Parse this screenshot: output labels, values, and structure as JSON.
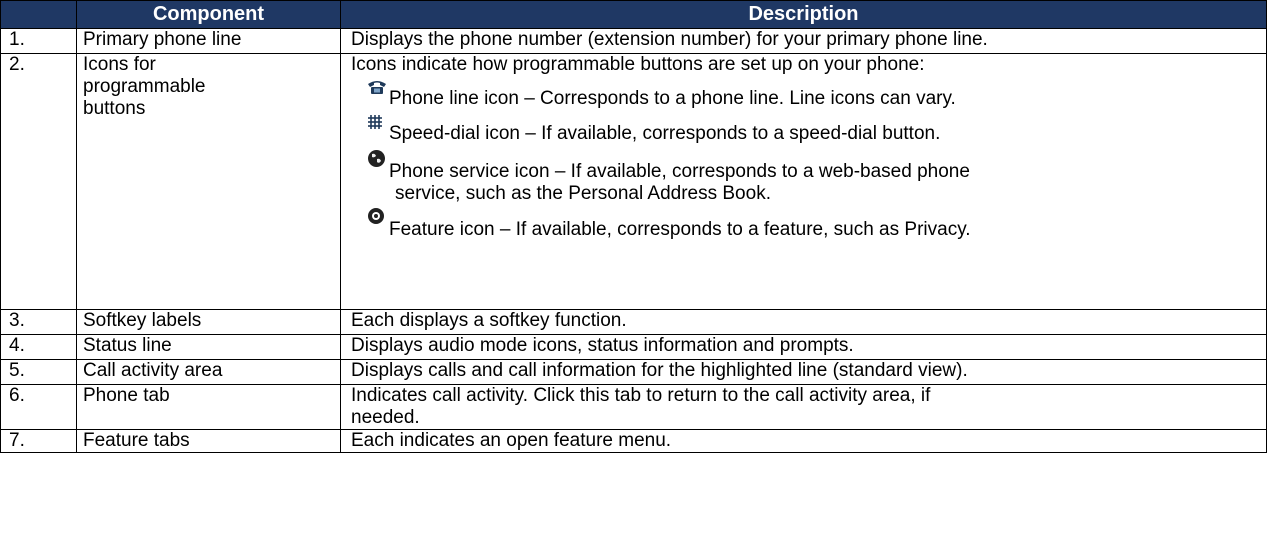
{
  "header": {
    "component": "Component",
    "description": "Description"
  },
  "rows": [
    {
      "num": "1.",
      "component": "Primary phone line",
      "description": "Displays the phone number (extension number) for your primary phone line."
    },
    {
      "num": "2.",
      "component": "Icons for programmable buttons",
      "description": "Icons indicate how programmable buttons are set up on your phone:",
      "icons": [
        {
          "icon": "phone-handset-icon",
          "text": "Phone line icon – Corresponds to a phone line.  Line icons can vary."
        },
        {
          "icon": "speed-dial-grid-icon",
          "text": "Speed-dial icon – If available, corresponds to a speed-dial button."
        },
        {
          "icon": "globe-service-icon",
          "text": "Phone service icon – If available, corresponds to a web-based phone",
          "text2": "service, such as the Personal Address Book."
        },
        {
          "icon": "feature-dot-icon",
          "text": "Feature icon – If available, corresponds to a feature, such as Privacy."
        }
      ]
    },
    {
      "num": "3.",
      "component": "Softkey labels",
      "description": "Each displays a softkey function."
    },
    {
      "num": "4.",
      "component": "Status line",
      "description": "Displays audio mode icons, status information and prompts."
    },
    {
      "num": "5.",
      "component": "Call activity area",
      "description": "Displays calls and call information for the highlighted line (standard view)."
    },
    {
      "num": "6.",
      "component": "Phone tab",
      "description": "Indicates call activity.   Click this tab to return to the call activity area, if",
      "description2": "needed."
    },
    {
      "num": "7.",
      "component": "Feature tabs",
      "description": "Each indicates an open feature menu."
    }
  ],
  "colors": {
    "header_bg": "#1f3864",
    "header_text": "#ffffff"
  }
}
